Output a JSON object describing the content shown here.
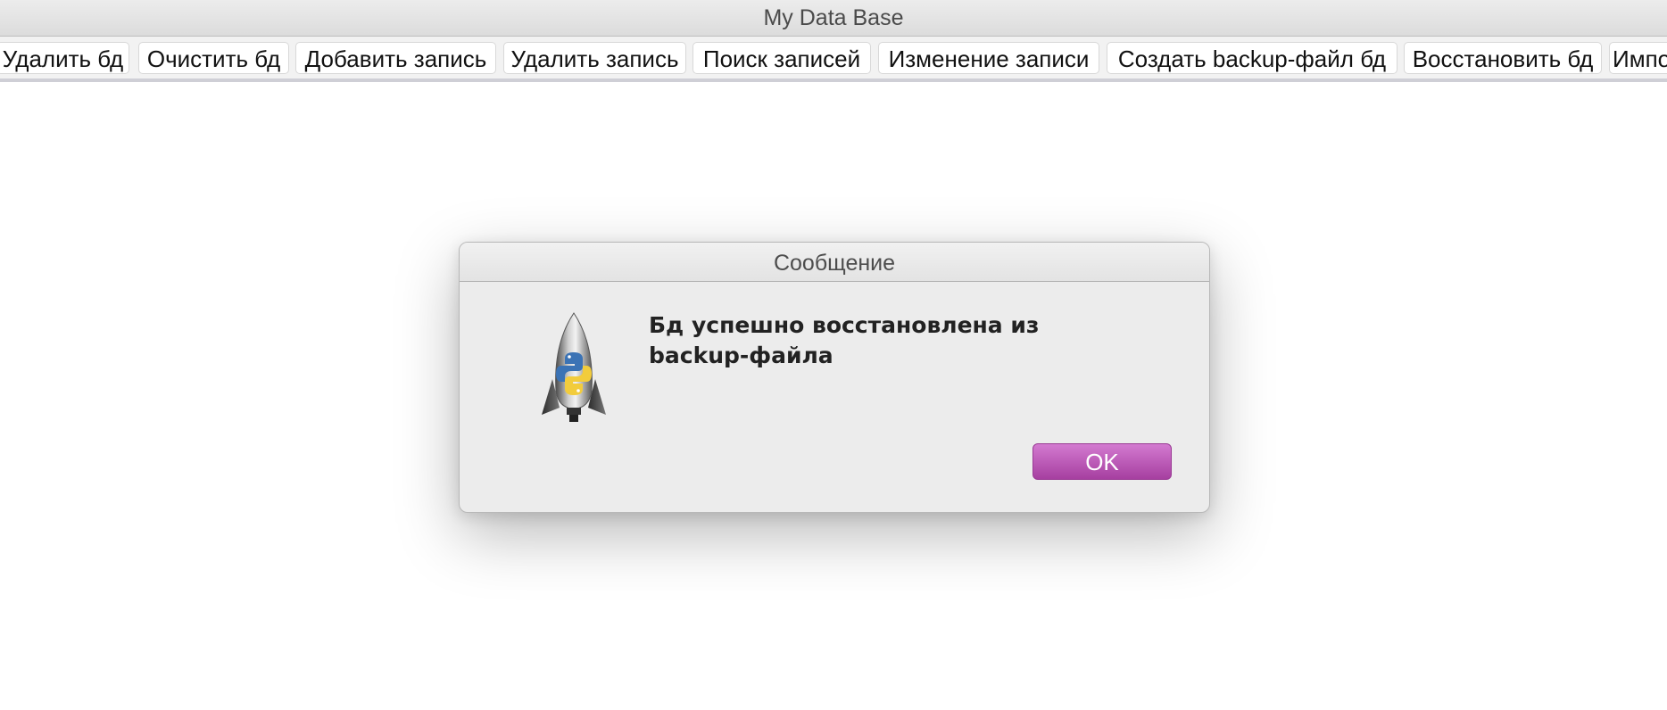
{
  "window": {
    "title": "My Data Base"
  },
  "toolbar": {
    "buttons": [
      {
        "label": "Удалить бд"
      },
      {
        "label": "Очистить бд"
      },
      {
        "label": "Добавить запись"
      },
      {
        "label": "Удалить запись"
      },
      {
        "label": "Поиск записей"
      },
      {
        "label": "Изменение записи"
      },
      {
        "label": "Создать backup-файл бд"
      },
      {
        "label": "Восстановить бд"
      },
      {
        "label": "Импо"
      }
    ]
  },
  "dialog": {
    "title": "Сообщение",
    "icon": "python-rocket-icon",
    "message_line1": "Бд успешно восстановлена из",
    "message_line2": "backup-файла",
    "ok_label": "OK"
  },
  "colors": {
    "accent_button": "#b34fae",
    "dialog_background": "#ececec"
  }
}
